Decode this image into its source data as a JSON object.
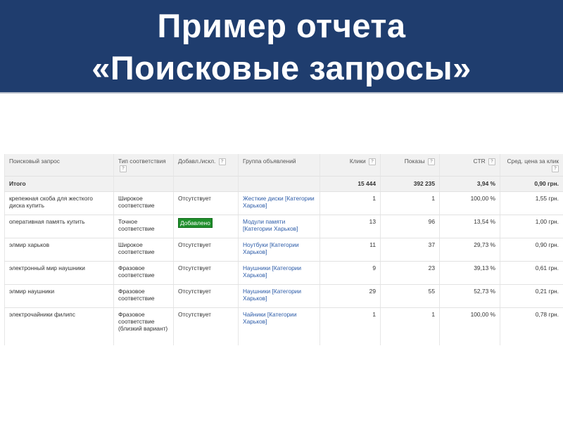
{
  "slide": {
    "title_line1": "Пример отчета",
    "title_line2": "«Поисковые запросы»"
  },
  "colors": {
    "header_bg": "#1f3d6e",
    "header_text": "#ffffff",
    "link": "#2d5ca8",
    "added_badge": "#1f8f2b"
  },
  "table": {
    "columns": [
      {
        "label": "Поисковый запрос",
        "help": false
      },
      {
        "label": "Тип соответствия",
        "help": true
      },
      {
        "label": "Добавл./искл.",
        "help": true
      },
      {
        "label": "Группа объявлений",
        "help": false
      },
      {
        "label": "Клики",
        "help": true
      },
      {
        "label": "Показы",
        "help": true
      },
      {
        "label": "CTR",
        "help": true
      },
      {
        "label": "Сред. цена за клик",
        "help": true
      }
    ],
    "help_glyph": "?",
    "total": {
      "label": "Итого",
      "clicks": "15 444",
      "impressions": "392 235",
      "ctr": "3,94 %",
      "avg_cpc": "0,90 грн."
    },
    "rows": [
      {
        "query": "крепежная скоба для жесткого диска купить",
        "match_type": "Широкое соответствие",
        "status": "Отсутствует",
        "status_added": false,
        "ad_group": "Жесткие диски [Категории Харьков]",
        "clicks": "1",
        "impressions": "1",
        "ctr": "100,00 %",
        "avg_cpc": "1,55 грн."
      },
      {
        "query": "оперативная память купить",
        "match_type": "Точное соответствие",
        "status": "Добавлено",
        "status_added": true,
        "ad_group": "Модули памяти [Категории Харьков]",
        "clicks": "13",
        "impressions": "96",
        "ctr": "13,54 %",
        "avg_cpc": "1,00 грн."
      },
      {
        "query": "элмир харьков",
        "match_type": "Широкое соответствие",
        "status": "Отсутствует",
        "status_added": false,
        "ad_group": "Ноутбуки [Категории Харьков]",
        "clicks": "11",
        "impressions": "37",
        "ctr": "29,73 %",
        "avg_cpc": "0,90 грн."
      },
      {
        "query": "электронный мир наушники",
        "match_type": "Фразовое соответствие",
        "status": "Отсутствует",
        "status_added": false,
        "ad_group": "Наушники [Категории Харьков]",
        "clicks": "9",
        "impressions": "23",
        "ctr": "39,13 %",
        "avg_cpc": "0,61 грн."
      },
      {
        "query": "элмир наушники",
        "match_type": "Фразовое соответствие",
        "status": "Отсутствует",
        "status_added": false,
        "ad_group": "Наушники [Категории Харьков]",
        "clicks": "29",
        "impressions": "55",
        "ctr": "52,73 %",
        "avg_cpc": "0,21 грн."
      },
      {
        "query": "электрочайники филипс",
        "match_type": "Фразовое соответствие (близкий вариант)",
        "status": "Отсутствует",
        "status_added": false,
        "ad_group": "Чайники [Категории Харьков]",
        "clicks": "1",
        "impressions": "1",
        "ctr": "100,00 %",
        "avg_cpc": "0,78 грн."
      }
    ]
  }
}
